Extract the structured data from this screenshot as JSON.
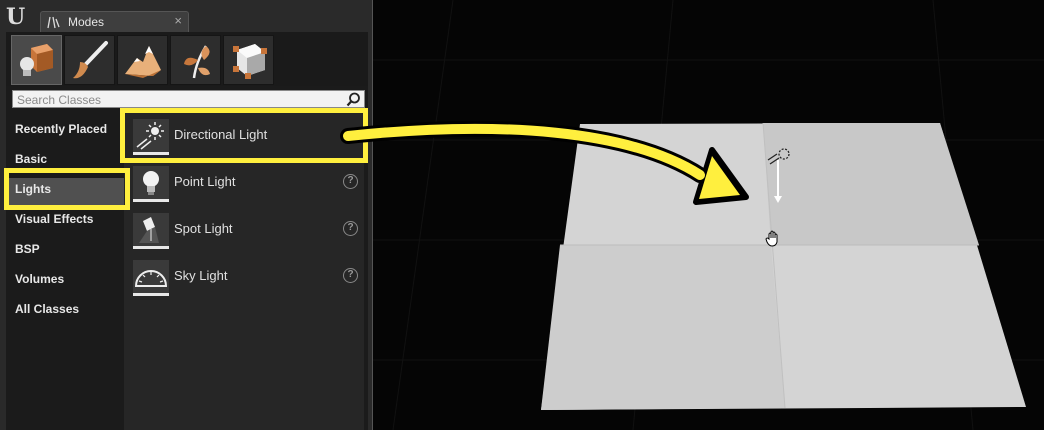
{
  "window": {
    "tab_title": "Modes",
    "tab_close_glyph": "×"
  },
  "mode_tabs": [
    {
      "name": "place-mode",
      "icon": "place-icon",
      "active": true
    },
    {
      "name": "paint-mode",
      "icon": "paint-brush-icon",
      "active": false
    },
    {
      "name": "landscape-mode",
      "icon": "landscape-icon",
      "active": false
    },
    {
      "name": "foliage-mode",
      "icon": "foliage-icon",
      "active": false
    },
    {
      "name": "geometry-mode",
      "icon": "geometry-icon",
      "active": false
    }
  ],
  "search": {
    "placeholder": "Search Classes"
  },
  "categories": [
    {
      "label": "Recently Placed"
    },
    {
      "label": "Basic"
    },
    {
      "label": "Lights",
      "selected": true
    },
    {
      "label": "Visual Effects"
    },
    {
      "label": "BSP"
    },
    {
      "label": "Volumes"
    },
    {
      "label": "All Classes"
    }
  ],
  "items": [
    {
      "label": "Directional Light",
      "icon": "directional-light-icon",
      "highlighted": true
    },
    {
      "label": "Point Light",
      "icon": "point-light-icon"
    },
    {
      "label": "Spot Light",
      "icon": "spot-light-icon"
    },
    {
      "label": "Sky Light",
      "icon": "sky-light-icon"
    }
  ],
  "colors": {
    "highlight": "#ffef3e",
    "panel_bg": "#2a2a2a",
    "viewport_bg": "#050505",
    "plane": "#d6d6d6"
  }
}
